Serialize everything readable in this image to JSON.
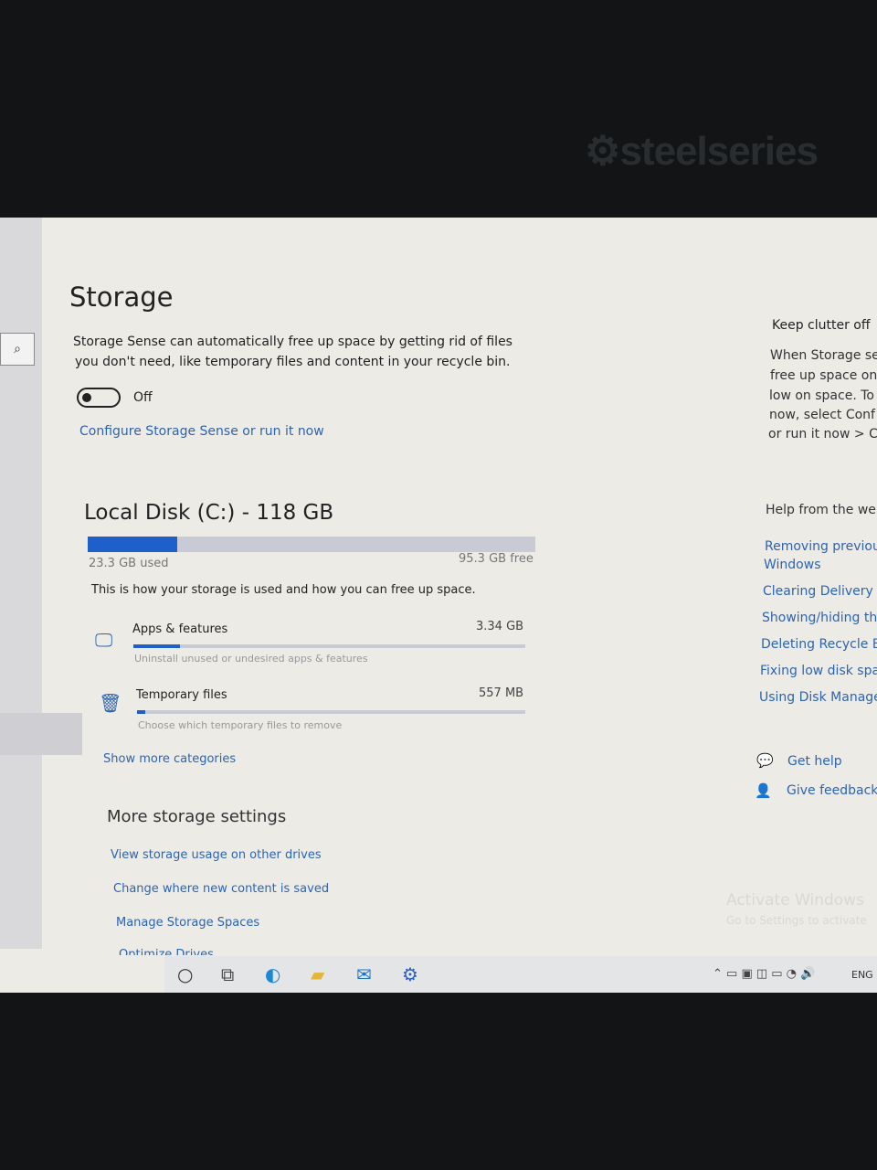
{
  "bezel": {
    "brand": "steelseries"
  },
  "page": {
    "title": "Storage",
    "storage_sense_desc_1": "Storage Sense can automatically free up space by getting rid of files",
    "storage_sense_desc_2": "you don't need, like temporary files and content in your recycle bin.",
    "toggle_state": "Off",
    "toggle_on": false,
    "configure_link": "Configure Storage Sense or run it now"
  },
  "disk": {
    "title": "Local Disk (C:) - 118 GB",
    "used": "23.3 GB used",
    "free": "95.3 GB free",
    "used_fraction": 0.2,
    "description": "This is how your storage is used and how you can free up space.",
    "categories": [
      {
        "name": "Apps & features",
        "size": "3.34 GB",
        "hint": "Uninstall unused or undesired apps & features",
        "icon": "monitor-icon",
        "fraction": 0.12
      },
      {
        "name": "Temporary files",
        "size": "557 MB",
        "hint": "Choose which temporary files to remove",
        "icon": "trash-icon",
        "fraction": 0.02
      }
    ],
    "show_more": "Show more categories"
  },
  "more": {
    "title": "More storage settings",
    "links": [
      "View storage usage on other drives",
      "Change where new content is saved",
      "Manage Storage Spaces",
      "Optimize Drives"
    ]
  },
  "right": {
    "heading": "Keep clutter off",
    "body": [
      "When Storage se",
      "free up space on",
      "low on space. To",
      "now, select Conf",
      "or run it now > C"
    ],
    "help_heading": "Help from the we",
    "help_links": [
      "Removing previou",
      "Windows",
      "Clearing Delivery C",
      "Showing/hiding th",
      "Deleting Recycle Bi",
      "Fixing low disk spa",
      "Using Disk Manage"
    ],
    "get_help": "Get help",
    "give_feedback": "Give feedback"
  },
  "watermark": {
    "line1": "Activate Windows",
    "line2": "Go to Settings to activate"
  },
  "taskbar": {
    "language": "ENG"
  },
  "colors": {
    "accent": "#1f5fc9",
    "link": "#2d64b0"
  }
}
